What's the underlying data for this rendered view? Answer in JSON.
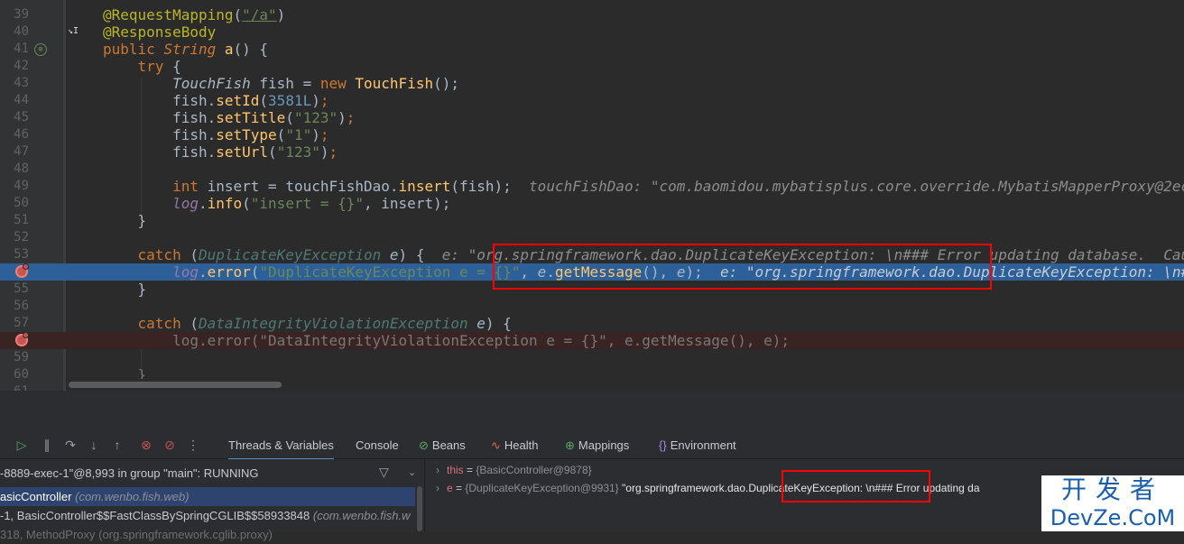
{
  "editor": {
    "line_numbers": [
      "39",
      "40",
      "41",
      "42",
      "43",
      "44",
      "45",
      "46",
      "47",
      "48",
      "49",
      "50",
      "51",
      "52",
      "53",
      "",
      "55",
      "56",
      "57",
      "",
      "59",
      "60",
      "61"
    ],
    "lines": {
      "l39": {
        "ann": "@RequestMapping",
        "str": "\"/a\""
      },
      "l40": {
        "ann": "@ResponseBody"
      },
      "l41": {
        "kw": "public",
        "type": "String",
        "name": "a",
        "rest": "() {"
      },
      "l42": {
        "kw": "try",
        "rest": " {"
      },
      "l43": {
        "type": "TouchFish",
        "var": "fish",
        "eq": " = ",
        "kw": "new",
        "ctor": "TouchFish",
        "rest": "();"
      },
      "l44": {
        "obj": "fish",
        "method": "setId",
        "num": "3581L"
      },
      "l45": {
        "obj": "fish",
        "method": "setTitle",
        "str": "\"123\""
      },
      "l46": {
        "obj": "fish",
        "method": "setType",
        "str": "\"1\""
      },
      "l47": {
        "obj": "fish",
        "method": "setUrl",
        "str": "\"123\""
      },
      "l49": {
        "kw": "int",
        "var": "insert",
        "dao": "touchFishDao",
        "method": "insert",
        "arg": "(fish);",
        "inline": "touchFishDao: \"com.baomidou.mybatisplus.core.override.MybatisMapperProxy@2ec..."
      },
      "l50": {
        "log": "log",
        "method": "info",
        "str": "\"insert = {}\"",
        "rest": ", insert);"
      },
      "l51": {
        "text": "}"
      },
      "l53": {
        "kw": "catch",
        "type": "DuplicateKeyException",
        "var": "e",
        "inline": "e: \"org.springframework.dao.DuplicateKeyException: \\n### Error updating database.  Cause: ..."
      },
      "l54": {
        "log": "log",
        "method": "error",
        "str": "\"DuplicateKeyException e = {}\"",
        "var": "e",
        "call": "getMessage",
        "inline": "e: \"org.springframework.dao.DuplicateKeyException: \\n### Error updating ..."
      },
      "l55": {
        "text": "}"
      },
      "l57": {
        "kw": "catch",
        "type": "DataIntegrityViolationException",
        "var": "e",
        "rest": ") {"
      },
      "l58": {
        "text": "log.error(\"DataIntegrityViolationException e = {}\", e.getMessage(), e);"
      },
      "l60": {
        "text": "}"
      }
    }
  },
  "debug": {
    "tabs": [
      "Threads & Variables",
      "Console",
      "Beans",
      "Health",
      "Mappings",
      "Environment"
    ],
    "active_tab": "Threads & Variables",
    "thread": "-8889-exec-1\"@8,993 in group \"main\": RUNNING",
    "frames": [
      {
        "text": "asicController",
        "pkg": "(com.wenbo.fish.web)"
      },
      {
        "text": "-1, BasicController$$FastClassBySpringCGLIB$$58933848",
        "pkg": "(com.wenbo.fish.w"
      },
      {
        "text": "318, MethodProxy (org.springframework.cglib.proxy)",
        "pkg": ""
      }
    ],
    "variables": [
      {
        "name": "this",
        "eq": " = ",
        "type": "{BasicController@9878}",
        "value": ""
      },
      {
        "name": "e",
        "eq": " = ",
        "type": "{DuplicateKeyException@9931}",
        "value": "\"org.springframework.dao.DuplicateKeyException: \\n### Error updating da"
      }
    ]
  },
  "watermark": {
    "cn": "开发者",
    "en": "DevZe.CoM"
  },
  "colors": {
    "exec_line": "#2d6099",
    "breakpoint": "#c75450",
    "annotation_box": "#ff0000"
  }
}
